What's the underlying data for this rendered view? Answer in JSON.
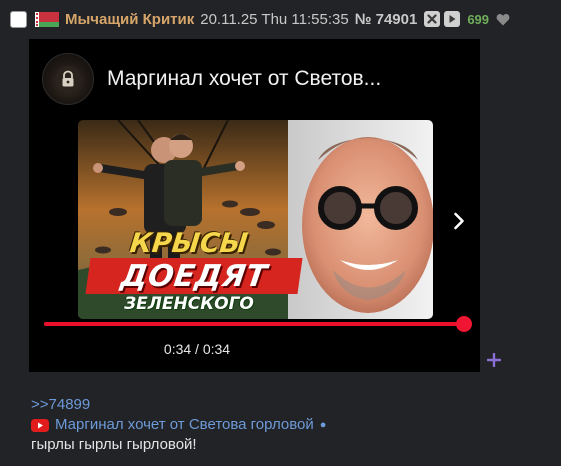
{
  "header": {
    "author": "Мычащий Критик",
    "datetime": "20.11.25 Thu 11:55:35",
    "post_number": "№ 74901",
    "likes": "699"
  },
  "embed": {
    "video_title": "Маргинал хочет от Светов...",
    "thumbnail": {
      "caption_line1": "КРЫСЫ",
      "caption_line2": "ДОЕДЯТ",
      "caption_line3": "ЗЕЛЕНСКОГО"
    },
    "time_display": "0:34 / 0:34",
    "progress_fraction": 1.0
  },
  "message": {
    "reply_link": ">>74899",
    "video_link": "Маргинал хочет от Светова горловой",
    "link_dot": "●",
    "text": "гырлы гырлы гырловой!"
  },
  "colors": {
    "background": "#222326",
    "author": "#d6a56a",
    "link": "#6d9ad8",
    "likes": "#6fae5a",
    "progress": "#e8102a",
    "expand_plus": "#8a6fd6"
  },
  "icons": {
    "checkbox": "select-checkbox",
    "flag": "belarus-flag-icon",
    "hide": "close-icon",
    "play": "play-icon",
    "like": "heart-icon",
    "next": "chevron-right-icon",
    "expand": "plus-icon",
    "youtube": "youtube-icon"
  }
}
